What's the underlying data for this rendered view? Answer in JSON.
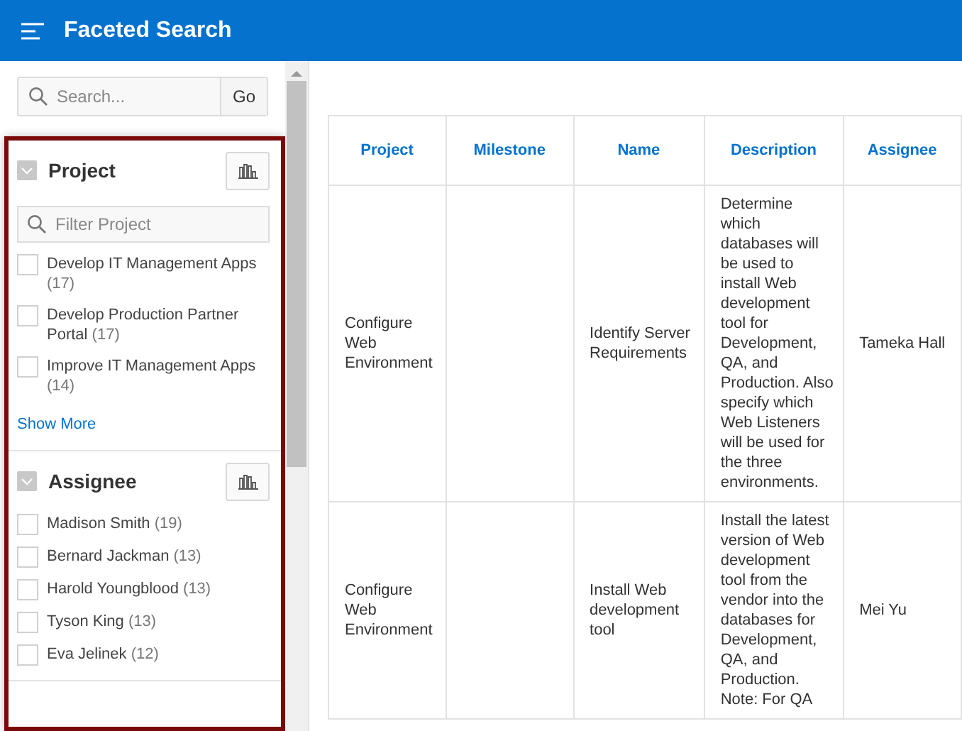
{
  "header": {
    "title": "Faceted Search"
  },
  "search": {
    "placeholder": "Search...",
    "button": "Go"
  },
  "facets": [
    {
      "title": "Project",
      "expanded": true,
      "filter_placeholder": "Filter Project",
      "show_more": "Show More",
      "options": [
        {
          "label": "Develop IT Management Apps",
          "count": "(17)",
          "checked": false
        },
        {
          "label": "Develop Production Partner Portal",
          "count": "(17)",
          "checked": false
        },
        {
          "label": "Improve IT Management Apps",
          "count": "(14)",
          "checked": false
        }
      ]
    },
    {
      "title": "Assignee",
      "expanded": true,
      "options": [
        {
          "label": "Madison Smith",
          "count": "(19)",
          "checked": false
        },
        {
          "label": "Bernard Jackman",
          "count": "(13)",
          "checked": false
        },
        {
          "label": "Harold Youngblood",
          "count": "(13)",
          "checked": false
        },
        {
          "label": "Tyson King",
          "count": "(13)",
          "checked": false
        },
        {
          "label": "Eva Jelinek",
          "count": "(12)",
          "checked": false
        }
      ]
    }
  ],
  "table": {
    "columns": [
      "Project",
      "Milestone",
      "Name",
      "Description",
      "Assignee"
    ],
    "rows": [
      {
        "cells": [
          "Configure Web Environment",
          "",
          "Identify Server Requirements",
          "Determine which databases will be used to install Web development tool for Development, QA, and Production. Also specify which Web Listeners will be used for the three environments.",
          "Tameka Hall"
        ]
      },
      {
        "cells": [
          "Configure Web Environment",
          "",
          "Install Web development tool",
          "Install the latest version of Web development tool from the vendor into the databases for Development, QA, and Production. Note: For QA",
          "Mei Yu"
        ]
      }
    ]
  }
}
